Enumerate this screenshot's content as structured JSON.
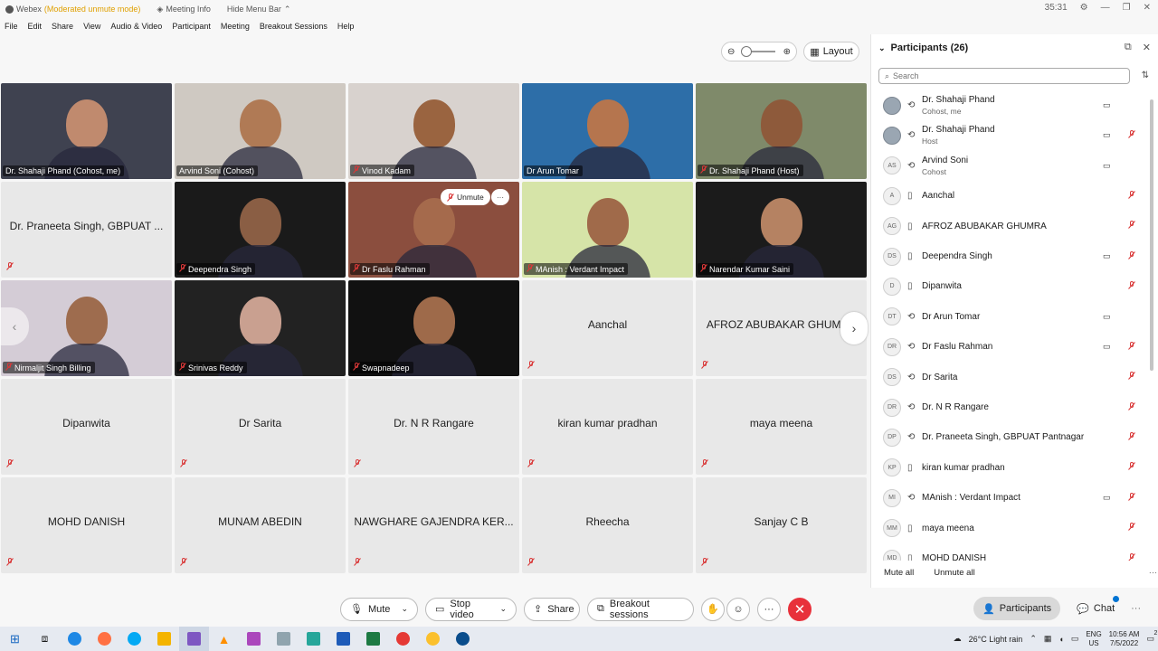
{
  "titlebar": {
    "app": "Webex",
    "mode": "(Moderated unmute mode)",
    "meeting_info": "Meeting Info",
    "hide_menu": "Hide Menu Bar",
    "timer": "35:31"
  },
  "menu": [
    "File",
    "Edit",
    "Share",
    "View",
    "Audio & Video",
    "Participant",
    "Meeting",
    "Breakout Sessions",
    "Help"
  ],
  "toolbar": {
    "layout_label": "Layout"
  },
  "tiles": [
    {
      "label": "Dr. Shahaji Phand (Cohost, me)",
      "video": true,
      "muted": false,
      "bg": "#3f4250",
      "skin": "#c08a6e"
    },
    {
      "label": "Arvind Soni (Cohost)",
      "video": true,
      "muted": false,
      "bg": "#cfc9c2",
      "skin": "#b07a55"
    },
    {
      "label": "Vinod Kadam",
      "video": true,
      "muted": true,
      "bg": "#d8d2ce",
      "skin": "#9a6440"
    },
    {
      "label": "Dr Arun Tomar",
      "video": true,
      "muted": false,
      "bg": "#2d6ea8",
      "skin": "#b5754e"
    },
    {
      "label": "Dr. Shahaji Phand (Host)",
      "video": true,
      "muted": true,
      "bg": "#7f8a6a",
      "skin": "#8e5a3b"
    },
    {
      "label": "Dr. Praneeta Singh, GBPUAT ...",
      "video": false,
      "muted": true
    },
    {
      "label": "Deependra Singh",
      "video": true,
      "muted": true,
      "bg": "#1a1a1a",
      "skin": "#8a5e44"
    },
    {
      "label": "Dr Faslu Rahman",
      "video": true,
      "muted": true,
      "bg": "#8b4e3e",
      "skin": "#a56a4c"
    },
    {
      "label": "MAnish : Verdant Impact",
      "video": true,
      "muted": true,
      "bg": "#d6e4a8",
      "skin": "#a06a4a"
    },
    {
      "label": "Narendar Kumar Saini",
      "video": true,
      "muted": true,
      "bg": "#1b1b1b",
      "skin": "#b58262"
    },
    {
      "label": "Nirmaljit Singh Billing",
      "video": true,
      "muted": true,
      "bg": "#d4ccd6",
      "skin": "#9e6c4e"
    },
    {
      "label": "Srinivas Reddy",
      "video": true,
      "muted": true,
      "bg": "#222",
      "skin": "#c9a090"
    },
    {
      "label": "Swapnadeep",
      "video": true,
      "muted": true,
      "bg": "#111",
      "skin": "#9e6a4a"
    },
    {
      "label": "Aanchal",
      "video": false,
      "muted": true
    },
    {
      "label": "AFROZ ABUBAKAR GHUMRA",
      "video": false,
      "muted": true
    },
    {
      "label": "Dipanwita",
      "video": false,
      "muted": true
    },
    {
      "label": "Dr Sarita",
      "video": false,
      "muted": true
    },
    {
      "label": "Dr. N R Rangare",
      "video": false,
      "muted": true
    },
    {
      "label": "kiran kumar pradhan",
      "video": false,
      "muted": true
    },
    {
      "label": "maya meena",
      "video": false,
      "muted": true
    },
    {
      "label": "MOHD DANISH",
      "video": false,
      "muted": true
    },
    {
      "label": "MUNAM ABEDIN",
      "video": false,
      "muted": true
    },
    {
      "label": "NAWGHARE GAJENDRA KER...",
      "video": false,
      "muted": true
    },
    {
      "label": "Rheecha",
      "video": false,
      "muted": true
    },
    {
      "label": "Sanjay C B",
      "video": false,
      "muted": true
    }
  ],
  "tile_hover": {
    "unmute_label": "Unmute",
    "more_label": "···"
  },
  "panel": {
    "title": "Participants (26)",
    "search_placeholder": "Search",
    "mute_all": "Mute all",
    "unmute_all": "Unmute all",
    "participants": [
      {
        "name": "Dr. Shahaji Phand",
        "role": "Cohost, me",
        "initials": "",
        "photo": true,
        "device": "link",
        "cam": true,
        "muted": false
      },
      {
        "name": "Dr. Shahaji Phand",
        "role": "Host",
        "initials": "",
        "photo": true,
        "device": "link",
        "cam": true,
        "muted": true
      },
      {
        "name": "Arvind Soni",
        "role": "Cohost",
        "initials": "AS",
        "photo": false,
        "device": "link",
        "cam": true,
        "muted": false
      },
      {
        "name": "Aanchal",
        "role": "",
        "initials": "A",
        "photo": false,
        "device": "phone",
        "cam": false,
        "muted": true
      },
      {
        "name": "AFROZ ABUBAKAR GHUMRA",
        "role": "",
        "initials": "AG",
        "photo": false,
        "device": "phone",
        "cam": false,
        "muted": true
      },
      {
        "name": "Deependra Singh",
        "role": "",
        "initials": "DS",
        "photo": false,
        "device": "phone",
        "cam": true,
        "muted": true
      },
      {
        "name": "Dipanwita",
        "role": "",
        "initials": "D",
        "photo": false,
        "device": "phone",
        "cam": false,
        "muted": true
      },
      {
        "name": "Dr Arun Tomar",
        "role": "",
        "initials": "DT",
        "photo": false,
        "device": "link",
        "cam": true,
        "muted": false
      },
      {
        "name": "Dr Faslu Rahman",
        "role": "",
        "initials": "DR",
        "photo": false,
        "device": "link",
        "cam": true,
        "muted": true
      },
      {
        "name": "Dr Sarita",
        "role": "",
        "initials": "DS",
        "photo": false,
        "device": "link",
        "cam": false,
        "muted": true
      },
      {
        "name": "Dr. N R Rangare",
        "role": "",
        "initials": "DR",
        "photo": false,
        "device": "link",
        "cam": false,
        "muted": true
      },
      {
        "name": "Dr. Praneeta Singh, GBPUAT Pantnagar",
        "role": "",
        "initials": "DP",
        "photo": false,
        "device": "link",
        "cam": false,
        "muted": true
      },
      {
        "name": "kiran kumar pradhan",
        "role": "",
        "initials": "KP",
        "photo": false,
        "device": "phone",
        "cam": false,
        "muted": true
      },
      {
        "name": "MAnish : Verdant Impact",
        "role": "",
        "initials": "MI",
        "photo": false,
        "device": "link",
        "cam": true,
        "muted": true
      },
      {
        "name": "maya meena",
        "role": "",
        "initials": "MM",
        "photo": false,
        "device": "phone",
        "cam": false,
        "muted": true
      },
      {
        "name": "MOHD DANISH",
        "role": "",
        "initials": "MD",
        "photo": false,
        "device": "phone",
        "cam": false,
        "muted": true
      }
    ]
  },
  "controls": {
    "mute": "Mute",
    "stop_video": "Stop video",
    "share": "Share",
    "breakout": "Breakout sessions",
    "participants_tab": "Participants",
    "chat_tab": "Chat"
  },
  "taskbar": {
    "weather": "26°C  Light rain",
    "lang1": "ENG",
    "lang2": "US",
    "time": "10:56 AM",
    "date": "7/5/2022",
    "notif": "2"
  },
  "colors": {
    "accent": "#0074d3",
    "red": "#e8313b",
    "mute_red": "#d93838"
  }
}
